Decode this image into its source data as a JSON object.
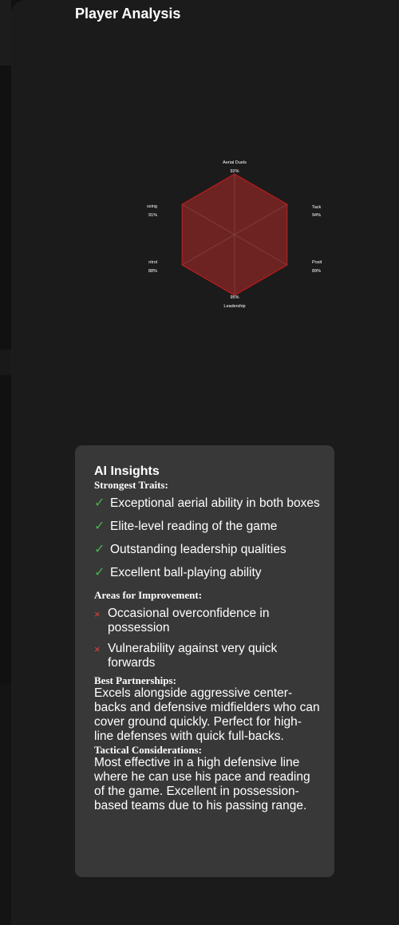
{
  "page": {
    "title": "Player Analysis"
  },
  "radar": {
    "labels": [
      {
        "name": "Aerial Duels",
        "value": "92%"
      },
      {
        "name": "Tack",
        "value": "94%"
      },
      {
        "name": "Posit",
        "value": "89%"
      },
      {
        "name": "Leadership",
        "value": "95%"
      },
      {
        "name": "ntrol",
        "value": "88%"
      },
      {
        "name": "ssing",
        "value": "91%"
      }
    ],
    "fill_color": "#6e2323",
    "stroke_color": "#b81c1c"
  },
  "chart_data": {
    "type": "radar",
    "categories": [
      "Aerial Duels",
      "Tack",
      "Posit",
      "Leadership",
      "ntrol",
      "ssing"
    ],
    "values": [
      92,
      94,
      89,
      95,
      88,
      91
    ]
  },
  "insights": {
    "title": "AI Insights",
    "strengths_heading": "Strongest Traits:",
    "strengths": [
      "Exceptional aerial ability in both boxes",
      "Elite-level reading of the game",
      "Outstanding leadership qualities",
      "Excellent ball-playing ability"
    ],
    "improvements_heading": "Areas for Improvement:",
    "improvements": [
      "Occasional overconfidence in possession",
      "Vulnerability against very quick forwards"
    ],
    "partnerships_heading": "Best Partnerships:",
    "partnerships_text": "Excels alongside aggressive center-backs and defensive midfielders who can cover ground quickly. Perfect for high-line defenses with quick full-backs.",
    "tactical_heading": "Tactical Considerations:",
    "tactical_text": "Most effective in a high defensive line where he can use his pace and reading of the game. Excellent in possession-based teams due to his passing range.",
    "check_icon": "✓",
    "cross_icon": "×"
  }
}
